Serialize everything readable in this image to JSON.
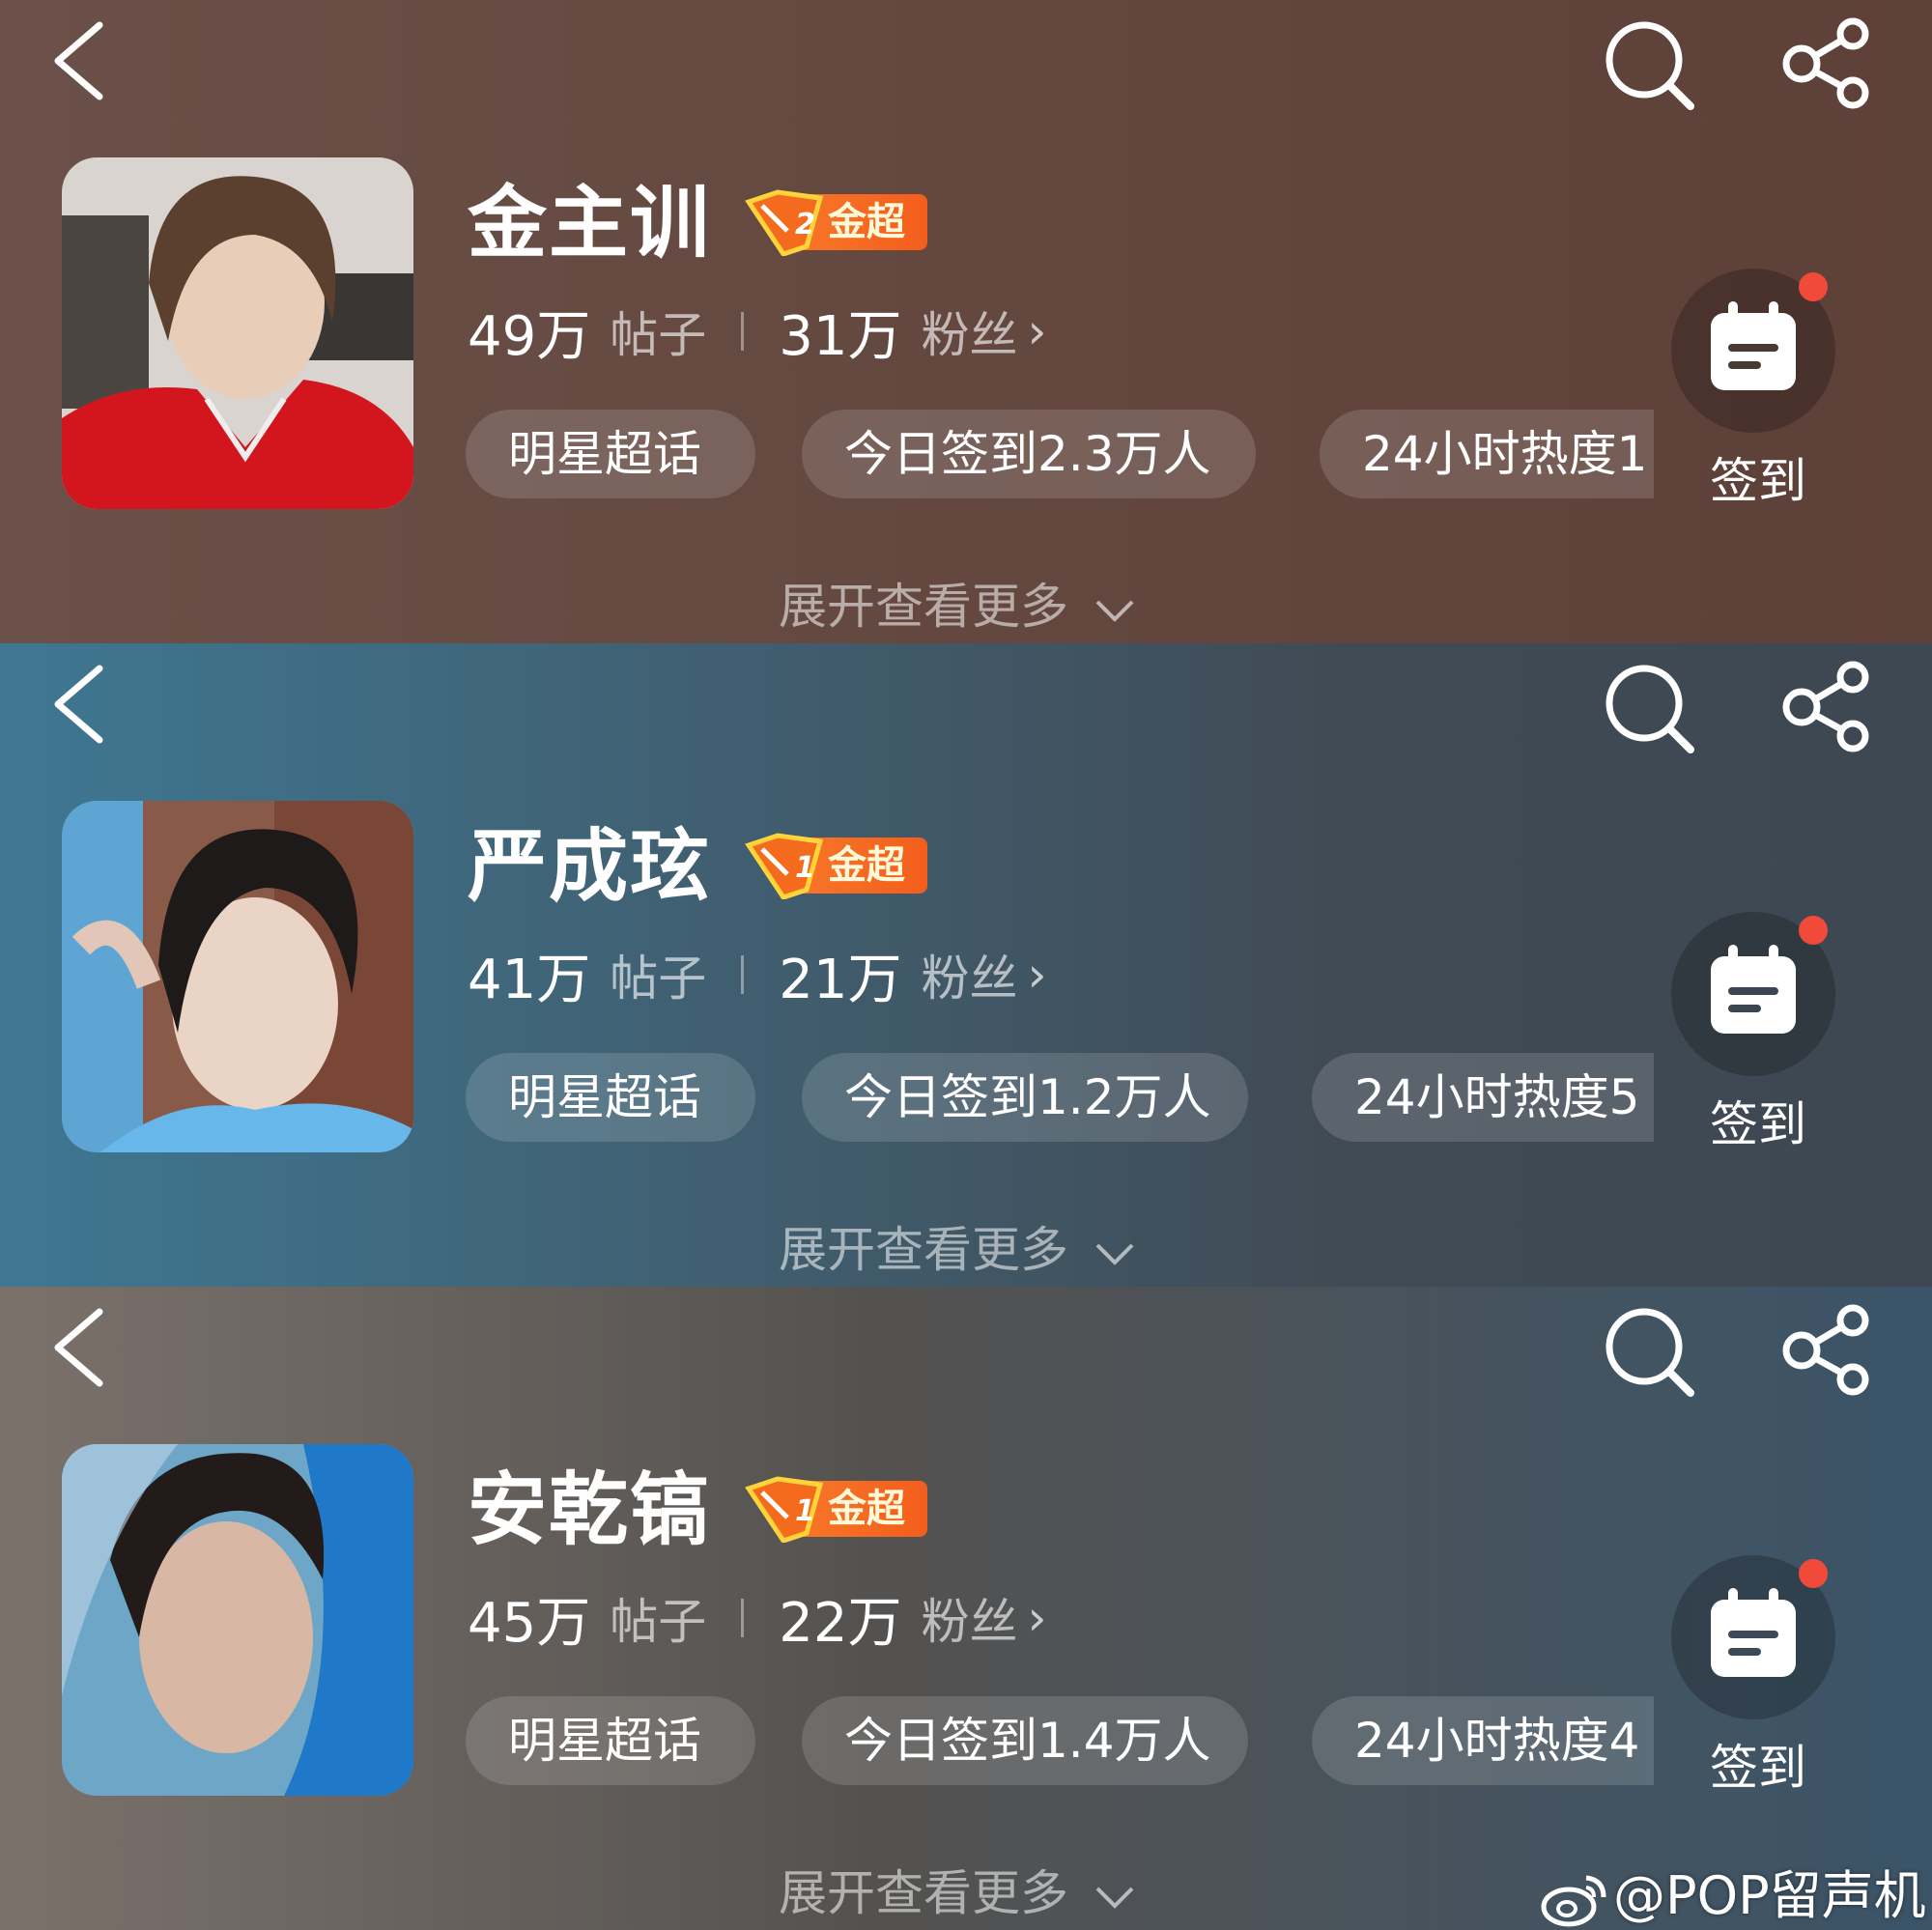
{
  "panels": [
    {
      "name": "金主训",
      "badge": {
        "level": "2",
        "label": "金超"
      },
      "posts": {
        "count": "49万",
        "label": "帖子"
      },
      "fans": {
        "count": "31万",
        "label": "粉丝"
      },
      "chips": [
        "明星超话",
        "今日签到2.3万人",
        "24小时热度1"
      ],
      "checkin_label": "签到",
      "expand_label": "展开查看更多"
    },
    {
      "name": "严成玹",
      "badge": {
        "level": "1",
        "label": "金超"
      },
      "posts": {
        "count": "41万",
        "label": "帖子"
      },
      "fans": {
        "count": "21万",
        "label": "粉丝"
      },
      "chips": [
        "明星超话",
        "今日签到1.2万人",
        "24小时热度5"
      ],
      "checkin_label": "签到",
      "expand_label": "展开查看更多"
    },
    {
      "name": "安乾镐",
      "badge": {
        "level": "1",
        "label": "金超"
      },
      "posts": {
        "count": "45万",
        "label": "帖子"
      },
      "fans": {
        "count": "22万",
        "label": "粉丝"
      },
      "chips": [
        "明星超话",
        "今日签到1.4万人",
        "24小时热度4"
      ],
      "checkin_label": "签到",
      "expand_label": "展开查看更多"
    }
  ],
  "watermark": "@POP留声机",
  "icons": [
    "back-icon",
    "search-icon",
    "share-icon",
    "calendar-icon",
    "weibo-logo-icon",
    "chevron-down-icon"
  ],
  "colors": {
    "badge": "#f35e1c",
    "notification_dot": "#f24a3a"
  }
}
